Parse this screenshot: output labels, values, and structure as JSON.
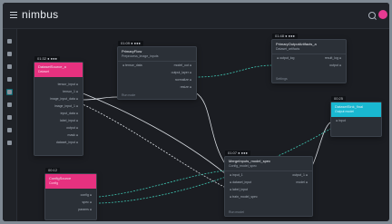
{
  "app": {
    "title": "nimbus"
  },
  "colors": {
    "accent": "#e6317f",
    "teal": "#19b8d1",
    "canvas": "#1b1d22",
    "node": "#2b3037"
  },
  "sidebar": {
    "items": [
      {
        "icon": "home-icon"
      },
      {
        "icon": "upload-icon"
      },
      {
        "icon": "cloud-icon"
      },
      {
        "icon": "settings-icon"
      },
      {
        "icon": "flow-icon",
        "active": true
      },
      {
        "icon": "refresh-icon"
      },
      {
        "icon": "share-icon"
      },
      {
        "icon": "help-icon"
      },
      {
        "icon": "gear-icon"
      }
    ]
  },
  "nodes": {
    "a": {
      "tag": "01:32 ● ●●●",
      "title": "DatasetSource_a",
      "sub": "Dataset",
      "rows": [
        {
          "l": "",
          "r": "tensor_input ●"
        },
        {
          "l": "",
          "r": "tensor_1 ●"
        },
        {
          "l": "",
          "r": "image_input_data ●"
        },
        {
          "l": "",
          "r": "image_input_1 ●"
        },
        {
          "l": "",
          "r": "input_data ●"
        },
        {
          "l": "",
          "r": "label_input ●"
        },
        {
          "l": "",
          "r": "output ●"
        },
        {
          "l": "",
          "r": "mask ●"
        },
        {
          "l": "",
          "r": "dataset_input ●"
        }
      ]
    },
    "b": {
      "tag": "01:09 ● ●●●",
      "title": "PrimaryFlow",
      "sub": "Preprocess_image_inputs",
      "rows": [
        {
          "l": "● tensor_data",
          "r": "model_out ●"
        },
        {
          "l": "",
          "r": "output_layer ●"
        },
        {
          "l": "",
          "r": "normalize ●"
        },
        {
          "l": "",
          "r": "resize ●"
        }
      ],
      "foot": "Run node"
    },
    "c": {
      "tag": "01:48 ● ●●●",
      "title": "PrimaryOutputArtifacts_a",
      "sub": "Dataset_artifacts",
      "rows": [
        {
          "l": "● output_log",
          "r": "result_log ●"
        },
        {
          "l": "",
          "r": "output ●"
        }
      ],
      "foot": "Settings"
    },
    "d": {
      "tag": "00:25",
      "title": "DatasetSink_final",
      "sub": "Output model",
      "rows": [
        {
          "l": "● input",
          "r": ""
        },
        {
          "l": "",
          "r": ""
        }
      ]
    },
    "e": {
      "tag": "01:07 ● ●●●",
      "title": "MergeInputs_model_spec",
      "sub": "Config_model_spec",
      "rows": [
        {
          "l": "● input_1",
          "r": "output_1 ●"
        },
        {
          "l": "● dataset_input",
          "r": "model ●"
        },
        {
          "l": "● label_input",
          "r": ""
        },
        {
          "l": "● train_model_spec",
          "r": ""
        }
      ],
      "foot": "Run model"
    },
    "f": {
      "tag": "00:12",
      "title": "ConfigSource",
      "sub": "Config",
      "rows": [
        {
          "l": "",
          "r": "config ●"
        },
        {
          "l": "",
          "r": "spec ●"
        },
        {
          "l": "",
          "r": "params ●"
        }
      ]
    }
  }
}
